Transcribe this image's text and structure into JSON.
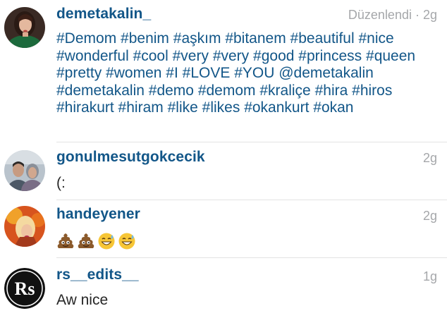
{
  "comments": [
    {
      "username": "demetakalin_",
      "meta": "Düzenlendi · 2g",
      "tokens": [
        "#Demom",
        "#benim",
        "#aşkım",
        "#bitanem",
        "#beautiful",
        "#nice",
        "#wonderful",
        "#cool",
        "#very",
        "#very",
        "#good",
        "#princess",
        "#queen",
        "#pretty",
        "#women",
        "#I",
        "#LOVE",
        "#YOU",
        "@demetakalin",
        "#demetakalin",
        "#demo",
        "#demom",
        "#kraliçe",
        "#hira",
        "#hiros",
        "#hirakurt",
        "#hiram",
        "#like",
        "#likes",
        "#okankurt",
        "#okan"
      ],
      "avatar_icon": "profile-photo-woman-dark-hair"
    },
    {
      "username": "gonulmesutgokcecik",
      "meta": "2g",
      "text": "(:",
      "avatar_icon": "profile-photo-couple"
    },
    {
      "username": "handeyener",
      "meta": "2g",
      "emojis": [
        "pile-of-poo-emoji",
        "pile-of-poo-emoji",
        "grinning-sweat-emoji",
        "grinning-sweat-emoji"
      ],
      "avatar_icon": "profile-photo-blonde-fire"
    },
    {
      "username": "rs__edits__",
      "meta": "1g",
      "text": "Aw nice",
      "avatar_text": "Rs",
      "avatar_icon": "rs-logo"
    }
  ],
  "colors": {
    "username": "#125688",
    "hashtag": "#125688",
    "text": "#262626",
    "meta": "#a5a7aa",
    "divider": "#e3e3e3"
  }
}
